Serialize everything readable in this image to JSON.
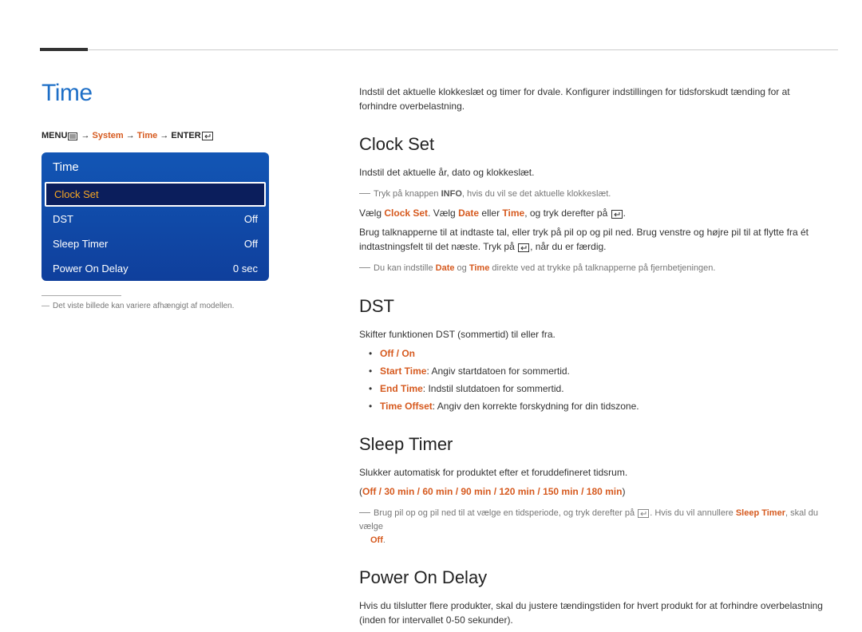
{
  "page_title": "Time",
  "breadcrumb": {
    "menu": "MENU",
    "arrow": " → ",
    "system": "System",
    "time": "Time",
    "enter": "ENTER"
  },
  "menu": {
    "header": "Time",
    "rows": [
      {
        "label": "Clock Set",
        "value": "",
        "selected": true
      },
      {
        "label": "DST",
        "value": "Off"
      },
      {
        "label": "Sleep Timer",
        "value": "Off"
      },
      {
        "label": "Power On Delay",
        "value": "0 sec"
      }
    ]
  },
  "left_footnote": "Det viste billede kan variere afhængigt af modellen.",
  "intro": "Indstil det aktuelle klokkeslæt og timer for dvale. Konfigurer indstillingen for tidsforskudt tænding for at forhindre overbelastning.",
  "clock_set": {
    "heading": "Clock Set",
    "p1": "Indstil det aktuelle år, dato og klokkeslæt.",
    "note1_pre": "Tryk på knappen ",
    "note1_bold": "INFO",
    "note1_post": ", hvis du vil se det aktuelle klokkeslæt.",
    "p2a": "Vælg ",
    "p2_clockset": "Clock Set",
    "p2b": ". Vælg ",
    "p2_date": "Date",
    "p2c": " eller ",
    "p2_time": "Time",
    "p2d": ", og tryk derefter på ",
    "p3": "Brug talknapperne til at indtaste tal, eller tryk på pil op og pil ned. Brug venstre og højre pil til at flytte fra ét indtastningsfelt til det næste. Tryk på ",
    "p3b": ", når du er færdig.",
    "note2_pre": "Du kan indstille ",
    "note2_date": "Date",
    "note2_mid": " og ",
    "note2_time": "Time",
    "note2_post": " direkte ved at trykke på talknapperne på fjernbetjeningen."
  },
  "dst": {
    "heading": "DST",
    "p1": "Skifter funktionen DST (sommertid) til eller fra.",
    "opt": "Off / On",
    "b1_label": "Start Time",
    "b1_text": ": Angiv startdatoen for sommertid.",
    "b2_label": "End Time",
    "b2_text": ": Indstil slutdatoen for sommertid.",
    "b3_label": "Time Offset",
    "b3_text": ": Angiv den korrekte forskydning for din tidszone."
  },
  "sleep": {
    "heading": "Sleep Timer",
    "p1": "Slukker automatisk for produktet efter et foruddefineret tidsrum.",
    "opts": "Off / 30 min / 60 min / 90 min / 120 min / 150 min / 180 min",
    "note_pre": "Brug pil op og pil ned til at vælge en tidsperiode, og tryk derefter på ",
    "note_mid": ". Hvis du vil annullere ",
    "note_sleep": "Sleep Timer",
    "note_post": ", skal du vælge ",
    "note_off": "Off"
  },
  "power": {
    "heading": "Power On Delay",
    "p1": "Hvis du tilslutter flere produkter, skal du justere tændingstiden for hvert produkt for at forhindre overbelastning (inden for intervallet 0-50 sekunder)."
  }
}
